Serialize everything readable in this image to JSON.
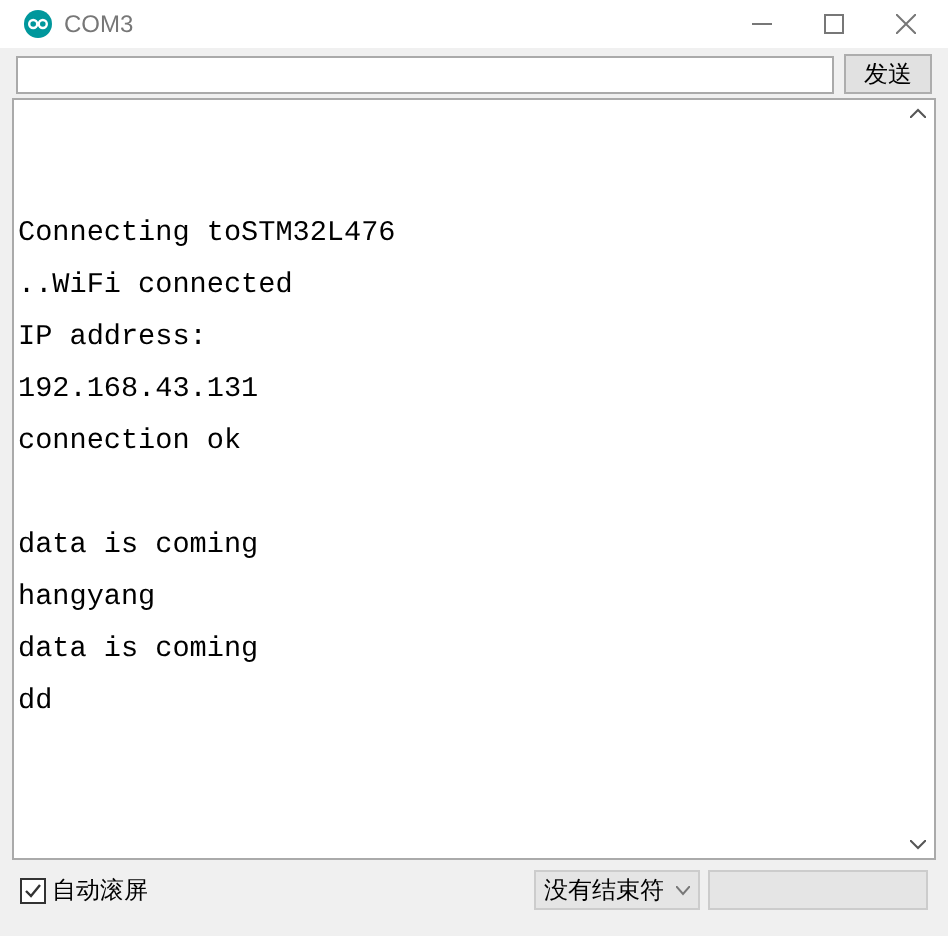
{
  "window": {
    "title": "COM3"
  },
  "send_button": "发送",
  "output": {
    "blocks": [
      [
        "Connecting toSTM32L476",
        "..WiFi connected",
        "IP address:",
        "192.168.43.131",
        "connection ok"
      ],
      [
        "data is coming",
        "hangyang",
        "data is coming",
        "dd"
      ]
    ]
  },
  "autoscroll": {
    "label": "自动滚屏",
    "checked": true
  },
  "line_ending": "没有结束符"
}
